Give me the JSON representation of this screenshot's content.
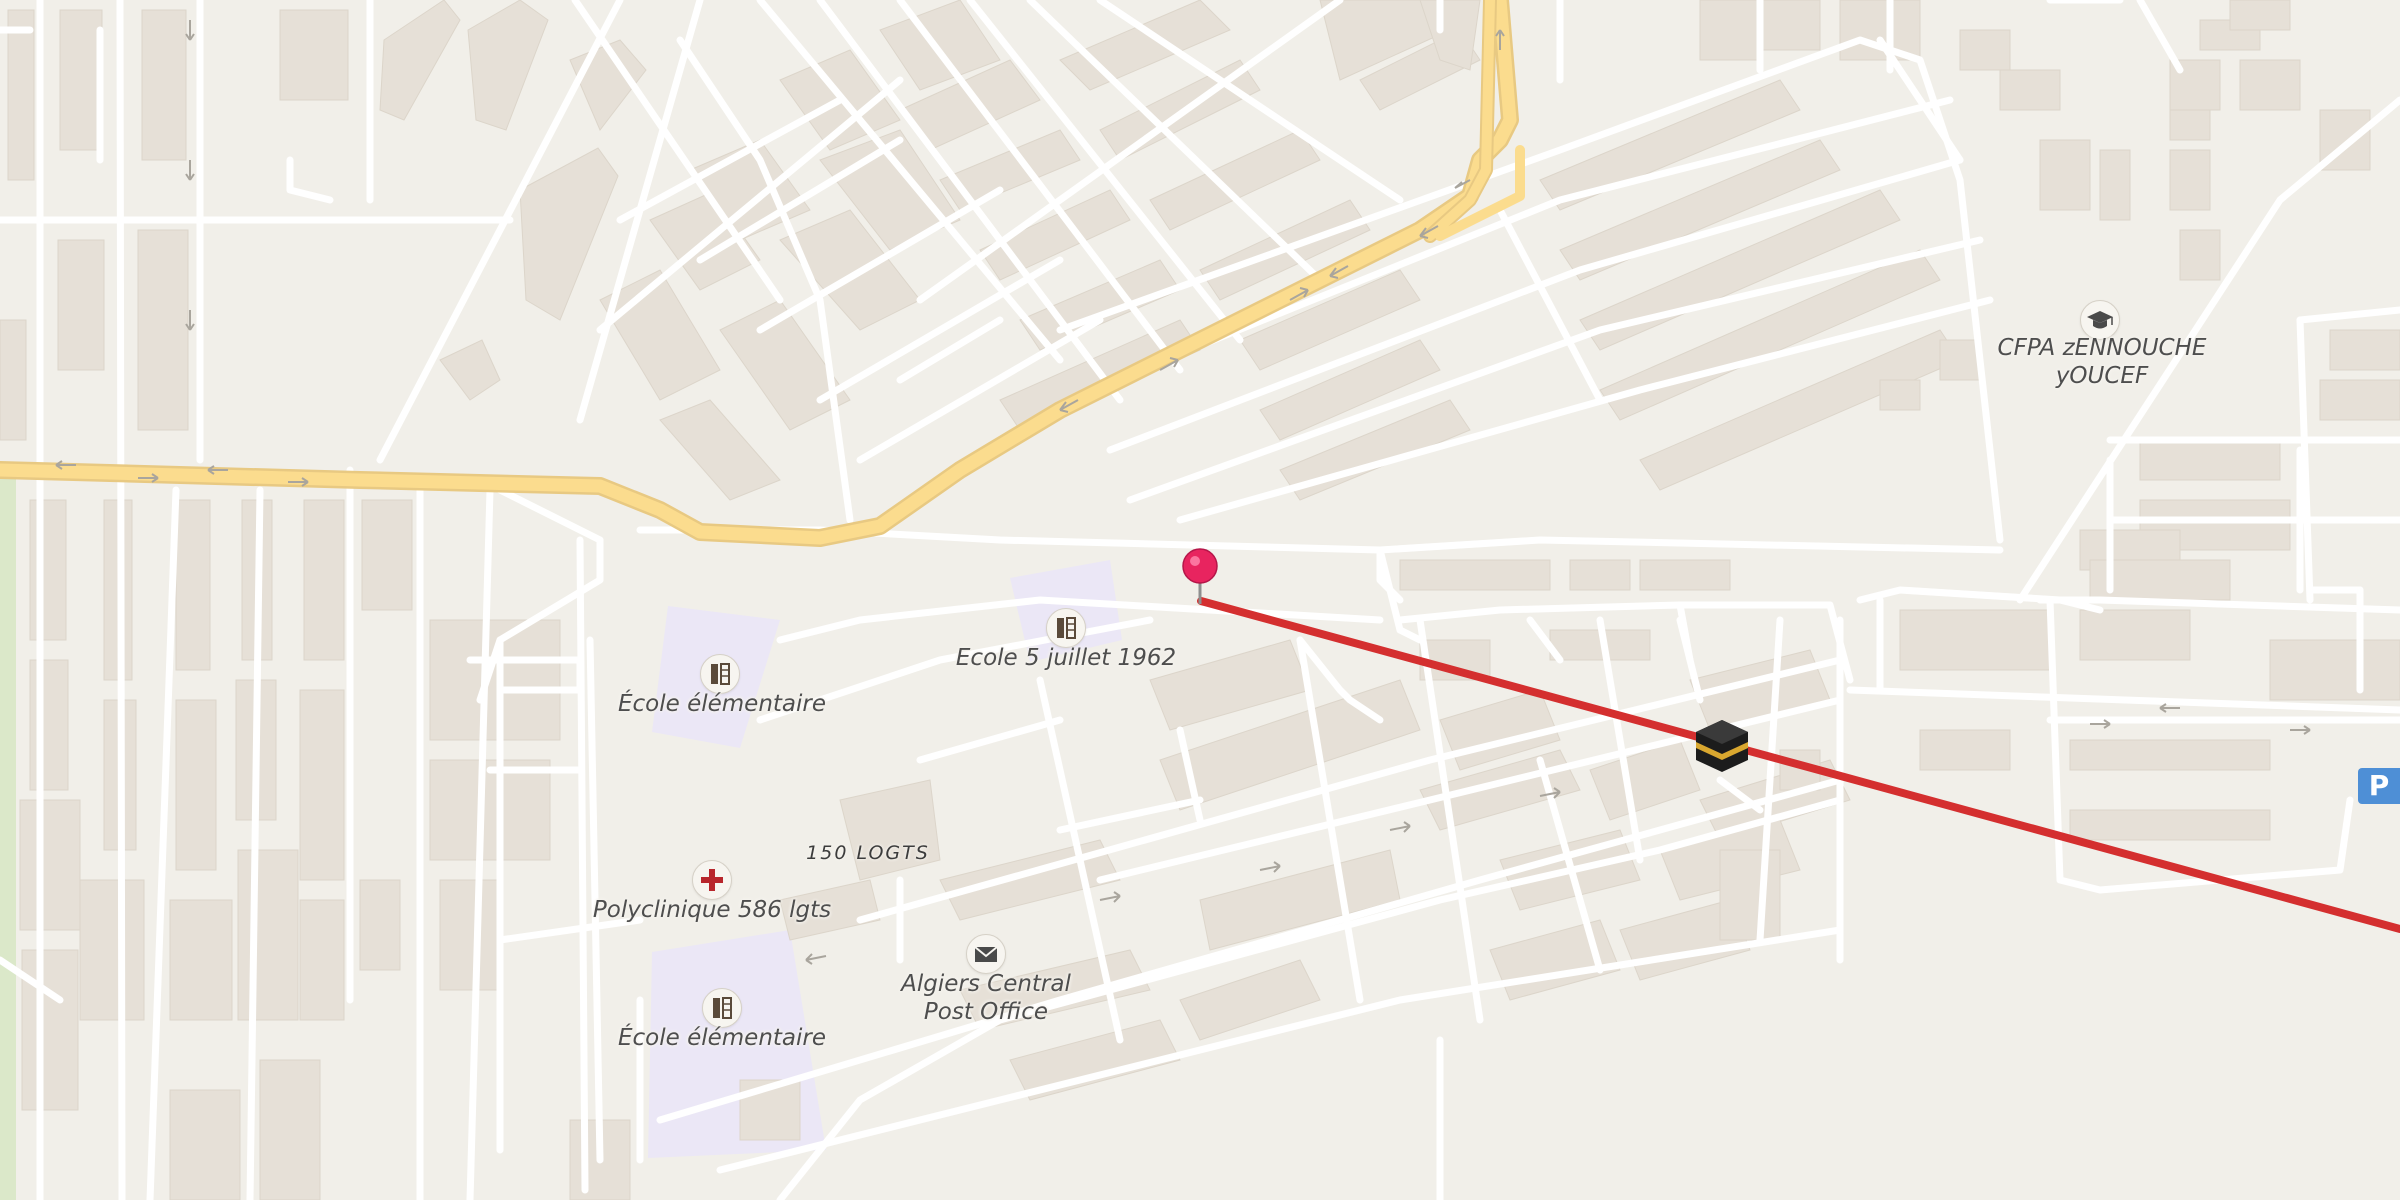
{
  "map": {
    "colors": {
      "background": "#f1efe9",
      "building": "#e6e0d7",
      "road": "#ffffff",
      "major_road": "#fbdc8e",
      "school_area": "#ebe7f6",
      "route_line": "#d42f2f",
      "pin": "#e8245f",
      "park_strip": "#dbe8c9",
      "parking": "#4e8fd6"
    },
    "labels": {
      "school_1": "École élémentaire",
      "school_2": "Ecole 5 juillet 1962",
      "school_3": "École élémentaire",
      "clinic": "Polyclinique 586 lgts",
      "post_office_line1": "Algiers Central",
      "post_office_line2": "Post Office",
      "training_center_line1": "CFPA zENNOUCHE",
      "training_center_line2": "yOUCEF",
      "area": "150 LOGTS"
    },
    "icons": {
      "school": "school-icon",
      "clinic": "medical-cross-icon",
      "post_office": "envelope-icon",
      "training_center": "graduation-cap-icon",
      "kaaba": "kaaba-icon",
      "pin": "location-pin-icon",
      "parking": "parking-icon"
    },
    "parking_label": "P"
  }
}
